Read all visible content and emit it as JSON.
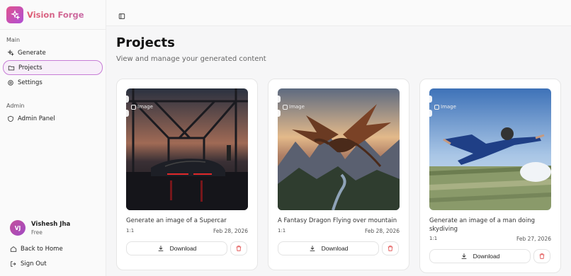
{
  "brand": {
    "name": "Vision Forge"
  },
  "sidebar": {
    "main_label": "Main",
    "main_items": [
      {
        "label": "Generate",
        "icon": "sparkles-icon"
      },
      {
        "label": "Projects",
        "icon": "folder-icon",
        "active": true
      },
      {
        "label": "Settings",
        "icon": "gear-icon"
      }
    ],
    "admin_label": "Admin",
    "admin_items": [
      {
        "label": "Admin Panel",
        "icon": "shield-icon"
      }
    ],
    "user": {
      "initials": "VJ",
      "name": "Vishesh Jha",
      "plan": "Free"
    },
    "bottom_links": [
      {
        "label": "Back to Home",
        "icon": "home-icon"
      },
      {
        "label": "Sign Out",
        "icon": "logout-icon"
      }
    ]
  },
  "page": {
    "title": "Projects",
    "subtitle": "View and manage your generated content"
  },
  "projects": [
    {
      "tag": "Image",
      "title": "Generate an image of a Supercar",
      "ratio": "1:1",
      "date": "Feb 28, 2026",
      "download_label": "Download"
    },
    {
      "tag": "Image",
      "title": "A Fantasy Dragon Flying over mountain",
      "ratio": "1:1",
      "date": "Feb 28, 2026",
      "download_label": "Download"
    },
    {
      "tag": "Image",
      "title": "Generate an image of a man doing skydiving",
      "ratio": "1:1",
      "date": "Feb 27, 2026",
      "download_label": "Download"
    }
  ],
  "colors": {
    "accent": "#c77dd6",
    "brand_start": "#e05b6f",
    "brand_end": "#c86aa6",
    "delete": "#e04848"
  }
}
